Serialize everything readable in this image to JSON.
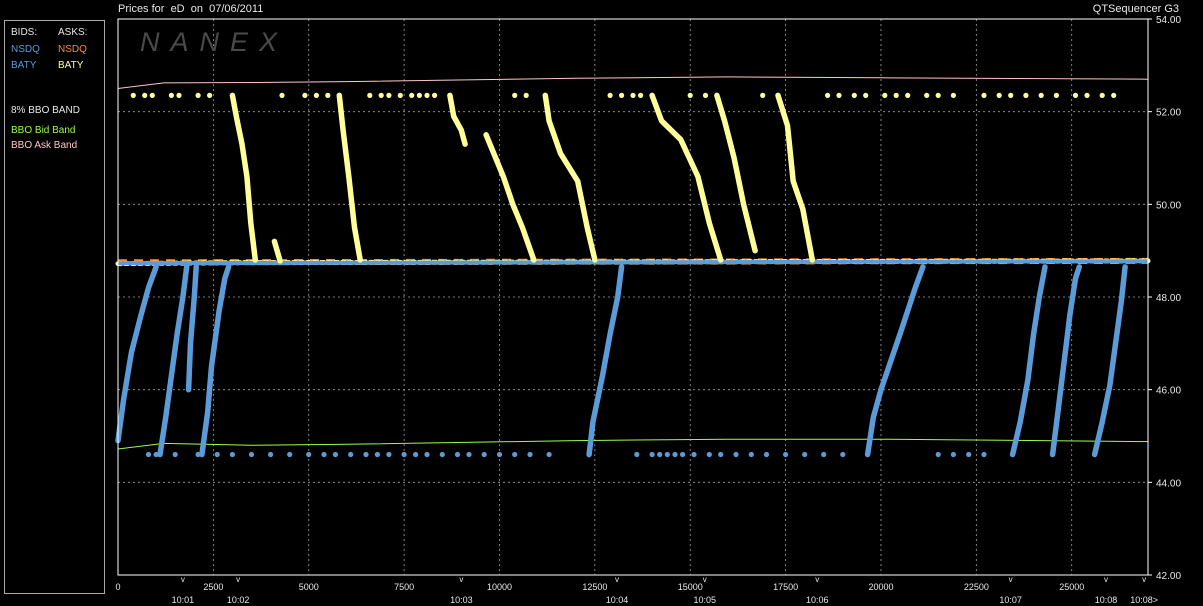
{
  "header": {
    "title": "Prices for  eD  on  07/06/2011",
    "app": "QTSequencer G3"
  },
  "watermark": "NANEX",
  "legend": {
    "bids_label": "BIDS:",
    "asks_label": "ASKS:",
    "bid_rows": [
      "NSDQ",
      "BATY"
    ],
    "ask_rows": [
      "NSDQ",
      "BATY"
    ],
    "band_title": "8% BBO BAND",
    "bid_band": "BBO Bid Band",
    "ask_band": "BBO Ask Band"
  },
  "colors": {
    "nsdq_bid": "#5b9bd8",
    "baty_bid": "#5b9bd8",
    "nsdq_ask": "#ff8c2a",
    "baty_ask": "#ffff9a",
    "bid_band": "#99ff44",
    "ask_band": "#ffc6c6",
    "grid": "#a0a0a0",
    "axes": "#ffffff"
  },
  "chart_data": {
    "type": "scatter",
    "title": "Prices for  eD  on  07/06/2011",
    "ylim": [
      42,
      54
    ],
    "xlim": [
      0,
      27000
    ],
    "y_ticks": [
      "42.00",
      "44.00",
      "46.00",
      "48.00",
      "50.00",
      "52.00",
      "54.00"
    ],
    "x_ticks": [
      "0",
      "2500",
      "5000",
      "7500",
      "10000",
      "12500",
      "15000",
      "17500",
      "20000",
      "22500",
      "25000"
    ],
    "time_labels": [
      {
        "x": 1700,
        "label": "10:01"
      },
      {
        "x": 3150,
        "label": "10:02"
      },
      {
        "x": 9000,
        "label": "10:03"
      },
      {
        "x": 13080,
        "label": "10:04"
      },
      {
        "x": 15380,
        "label": "10:05"
      },
      {
        "x": 18330,
        "label": "10:06"
      },
      {
        "x": 23400,
        "label": "10:07"
      },
      {
        "x": 25900,
        "label": "10:08"
      },
      {
        "x": 26900,
        "label": "10:08>"
      }
    ],
    "grid": true,
    "series": [
      {
        "name": "BBO Ask Band",
        "kind": "line",
        "points": [
          [
            0,
            52.5
          ],
          [
            1200,
            52.62
          ],
          [
            3500,
            52.63
          ],
          [
            6000,
            52.65
          ],
          [
            12000,
            52.72
          ],
          [
            16000,
            52.75
          ],
          [
            20000,
            52.73
          ],
          [
            27000,
            52.7
          ]
        ]
      },
      {
        "name": "BBO Bid Band",
        "kind": "line",
        "points": [
          [
            0,
            44.72
          ],
          [
            1200,
            44.84
          ],
          [
            3500,
            44.8
          ],
          [
            6000,
            44.82
          ],
          [
            12000,
            44.9
          ],
          [
            16000,
            44.93
          ],
          [
            20000,
            44.93
          ],
          [
            27000,
            44.88
          ]
        ]
      },
      {
        "name": "NSDQ",
        "side": "ask",
        "kind": "trace",
        "points": [
          [
            0,
            48.75
          ],
          [
            27000,
            48.78
          ]
        ]
      },
      {
        "name": "BATY",
        "side": "ask",
        "kind": "dots_trace",
        "points": [
          [
            0,
            48.72
          ],
          [
            3000,
            48.74
          ],
          [
            27000,
            48.78
          ]
        ]
      },
      {
        "name": "NSDQ",
        "side": "bid",
        "kind": "trace",
        "points": [
          [
            0,
            48.73
          ],
          [
            27000,
            48.77
          ]
        ]
      },
      {
        "name": "BATY",
        "side": "ask",
        "kind": "ramps",
        "ramps": [
          [
            [
              3000,
              52.35
            ],
            [
              3100,
              51.9
            ],
            [
              3250,
              51.3
            ],
            [
              3380,
              50.6
            ],
            [
              3480,
              49.6
            ],
            [
              3600,
              48.8
            ]
          ],
          [
            [
              4100,
              49.2
            ],
            [
              4250,
              48.78
            ]
          ],
          [
            [
              5800,
              52.35
            ],
            [
              5900,
              51.6
            ],
            [
              6050,
              50.6
            ],
            [
              6200,
              49.5
            ],
            [
              6350,
              48.8
            ]
          ],
          [
            [
              8700,
              52.35
            ],
            [
              8800,
              51.9
            ],
            [
              9000,
              51.6
            ],
            [
              9100,
              51.3
            ]
          ],
          [
            [
              9650,
              51.5
            ],
            [
              10100,
              50.6
            ],
            [
              10350,
              50.0
            ],
            [
              10600,
              49.5
            ],
            [
              10900,
              48.8
            ]
          ],
          [
            [
              11200,
              52.35
            ],
            [
              11300,
              51.8
            ],
            [
              11600,
              51.1
            ],
            [
              12050,
              50.5
            ],
            [
              12300,
              49.5
            ],
            [
              12500,
              48.8
            ]
          ],
          [
            [
              14000,
              52.35
            ],
            [
              14250,
              51.8
            ],
            [
              14750,
              51.4
            ],
            [
              15200,
              50.6
            ],
            [
              15500,
              49.6
            ],
            [
              15800,
              48.8
            ]
          ],
          [
            [
              15700,
              52.35
            ],
            [
              15900,
              51.8
            ],
            [
              16150,
              51.0
            ],
            [
              16400,
              50.0
            ],
            [
              16700,
              49.0
            ]
          ],
          [
            [
              17300,
              52.35
            ],
            [
              17550,
              51.7
            ],
            [
              17700,
              50.5
            ],
            [
              17950,
              49.9
            ],
            [
              18200,
              48.8
            ]
          ]
        ]
      },
      {
        "name": "BATY",
        "side": "ask",
        "kind": "scatter",
        "points": [
          [
            400,
            52.35
          ],
          [
            700,
            52.35
          ],
          [
            900,
            52.35
          ],
          [
            1400,
            52.35
          ],
          [
            1600,
            52.35
          ],
          [
            2100,
            52.35
          ],
          [
            2400,
            52.35
          ],
          [
            4300,
            52.35
          ],
          [
            4900,
            52.35
          ],
          [
            5200,
            52.35
          ],
          [
            5500,
            52.35
          ],
          [
            6600,
            52.35
          ],
          [
            6900,
            52.35
          ],
          [
            7100,
            52.35
          ],
          [
            7400,
            52.35
          ],
          [
            7700,
            52.35
          ],
          [
            7900,
            52.35
          ],
          [
            8100,
            52.35
          ],
          [
            8300,
            52.35
          ],
          [
            10400,
            52.35
          ],
          [
            10700,
            52.35
          ],
          [
            12900,
            52.35
          ],
          [
            13200,
            52.35
          ],
          [
            13500,
            52.35
          ],
          [
            13700,
            52.35
          ],
          [
            15000,
            52.35
          ],
          [
            15400,
            52.35
          ],
          [
            16900,
            52.35
          ],
          [
            18600,
            52.35
          ],
          [
            18900,
            52.35
          ],
          [
            19300,
            52.35
          ],
          [
            19600,
            52.35
          ],
          [
            20100,
            52.35
          ],
          [
            20400,
            52.35
          ],
          [
            20700,
            52.35
          ],
          [
            21200,
            52.35
          ],
          [
            21500,
            52.35
          ],
          [
            21900,
            52.35
          ],
          [
            22700,
            52.35
          ],
          [
            23100,
            52.35
          ],
          [
            23400,
            52.35
          ],
          [
            23800,
            52.35
          ],
          [
            24200,
            52.35
          ],
          [
            24600,
            52.35
          ],
          [
            25100,
            52.35
          ],
          [
            25400,
            52.35
          ],
          [
            25800,
            52.35
          ],
          [
            26100,
            52.35
          ]
        ]
      },
      {
        "name": "BATY",
        "side": "bid",
        "kind": "ramps",
        "ramps": [
          [
            [
              0,
              44.9
            ],
            [
              150,
              45.8
            ],
            [
              350,
              46.8
            ],
            [
              600,
              47.6
            ],
            [
              800,
              48.2
            ],
            [
              1000,
              48.65
            ]
          ],
          [
            [
              1100,
              44.6
            ],
            [
              1250,
              45.4
            ],
            [
              1400,
              46.3
            ],
            [
              1550,
              47.2
            ],
            [
              1700,
              48.0
            ],
            [
              1800,
              48.65
            ]
          ],
          [
            [
              1850,
              46.0
            ],
            [
              1900,
              47.0
            ],
            [
              2000,
              48.0
            ],
            [
              2050,
              48.65
            ]
          ],
          [
            [
              2200,
              44.6
            ],
            [
              2350,
              45.5
            ],
            [
              2450,
              46.5
            ],
            [
              2650,
              47.7
            ],
            [
              2800,
              48.4
            ],
            [
              2900,
              48.65
            ]
          ],
          [
            [
              12350,
              44.6
            ],
            [
              12450,
              45.3
            ],
            [
              12700,
              46.3
            ],
            [
              12900,
              47.2
            ],
            [
              13100,
              48.0
            ],
            [
              13200,
              48.65
            ]
          ],
          [
            [
              19650,
              44.6
            ],
            [
              19800,
              45.4
            ],
            [
              20000,
              46.0
            ],
            [
              20250,
              46.6
            ],
            [
              20500,
              47.2
            ],
            [
              20700,
              47.7
            ],
            [
              20900,
              48.2
            ],
            [
              21100,
              48.65
            ]
          ],
          [
            [
              23450,
              44.6
            ],
            [
              23650,
              45.3
            ],
            [
              23850,
              46.2
            ],
            [
              24000,
              47.2
            ],
            [
              24150,
              48.0
            ],
            [
              24300,
              48.65
            ]
          ],
          [
            [
              24500,
              44.6
            ],
            [
              24650,
              45.6
            ],
            [
              24800,
              46.6
            ],
            [
              24950,
              47.6
            ],
            [
              25100,
              48.4
            ],
            [
              25200,
              48.65
            ]
          ],
          [
            [
              25600,
              44.6
            ],
            [
              25800,
              45.3
            ],
            [
              26000,
              46.1
            ],
            [
              26150,
              47.0
            ],
            [
              26300,
              47.9
            ],
            [
              26400,
              48.65
            ]
          ]
        ]
      },
      {
        "name": "BATY",
        "side": "bid",
        "kind": "scatter",
        "points": [
          [
            800,
            44.6
          ],
          [
            1000,
            44.6
          ],
          [
            1500,
            44.6
          ],
          [
            2100,
            44.6
          ],
          [
            2600,
            44.6
          ],
          [
            3000,
            44.6
          ],
          [
            3500,
            44.6
          ],
          [
            4000,
            44.6
          ],
          [
            4500,
            44.6
          ],
          [
            5000,
            44.6
          ],
          [
            5400,
            44.6
          ],
          [
            5700,
            44.6
          ],
          [
            6100,
            44.6
          ],
          [
            6500,
            44.6
          ],
          [
            6800,
            44.6
          ],
          [
            7100,
            44.6
          ],
          [
            7500,
            44.6
          ],
          [
            7800,
            44.6
          ],
          [
            8100,
            44.6
          ],
          [
            8500,
            44.6
          ],
          [
            8900,
            44.6
          ],
          [
            9200,
            44.6
          ],
          [
            9600,
            44.6
          ],
          [
            10000,
            44.6
          ],
          [
            10400,
            44.6
          ],
          [
            10800,
            44.6
          ],
          [
            11300,
            44.6
          ],
          [
            13600,
            44.6
          ],
          [
            14000,
            44.6
          ],
          [
            14200,
            44.6
          ],
          [
            14400,
            44.6
          ],
          [
            14600,
            44.6
          ],
          [
            14800,
            44.6
          ],
          [
            15100,
            44.6
          ],
          [
            15500,
            44.6
          ],
          [
            15800,
            44.6
          ],
          [
            16200,
            44.6
          ],
          [
            16600,
            44.6
          ],
          [
            17000,
            44.6
          ],
          [
            17500,
            44.6
          ],
          [
            18000,
            44.6
          ],
          [
            18500,
            44.6
          ],
          [
            19000,
            44.6
          ],
          [
            21500,
            44.6
          ],
          [
            21900,
            44.6
          ],
          [
            22300,
            44.6
          ],
          [
            22700,
            44.6
          ]
        ]
      }
    ]
  }
}
